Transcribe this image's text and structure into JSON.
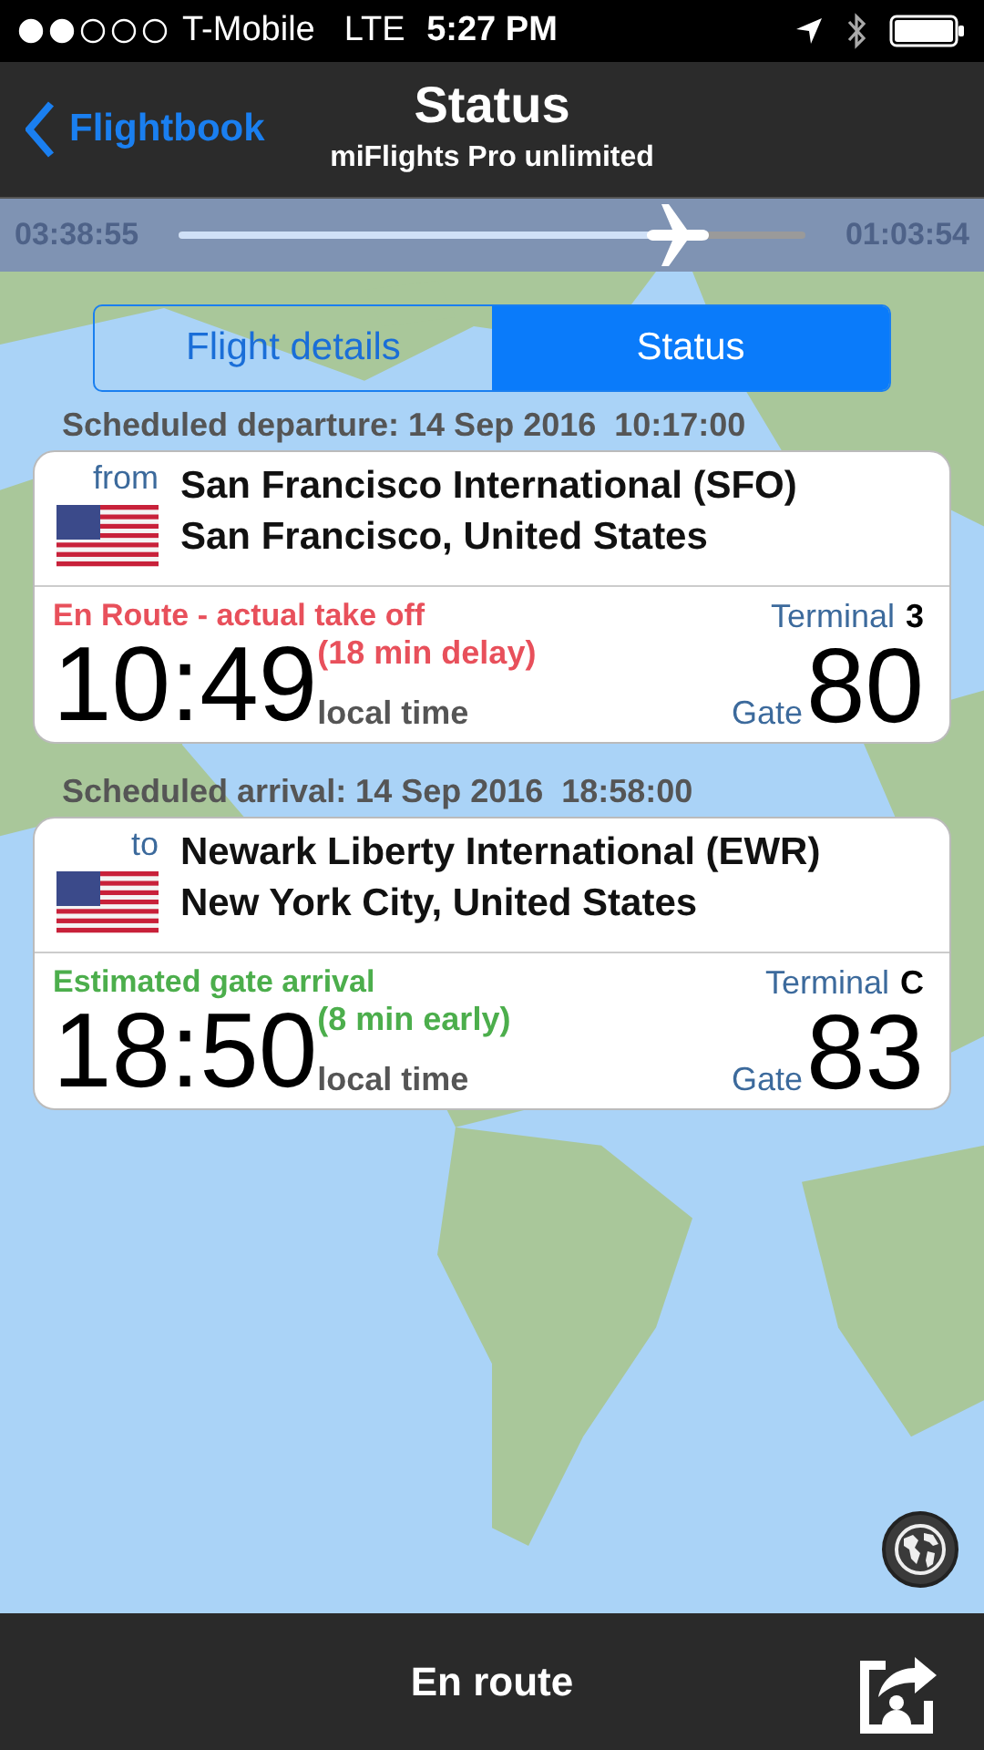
{
  "status_bar": {
    "carrier": "T-Mobile",
    "network": "LTE",
    "time": "5:27 PM"
  },
  "nav": {
    "back": "Flightbook",
    "title": "Status",
    "subtitle": "miFlights Pro unlimited"
  },
  "progress": {
    "elapsed": "03:38:55",
    "remaining": "01:03:54",
    "level": 0.8
  },
  "tabs": [
    {
      "label": "Flight details",
      "selected": false
    },
    {
      "label": "Status",
      "selected": true
    }
  ],
  "legs": [
    {
      "scheduled": "Scheduled departure: 14 Sep 2016  10:17:00",
      "direction": "from",
      "airport": "San Francisco International (SFO)",
      "city": "San Francisco, United States",
      "kind": "delay",
      "status": "En Route - actual take off",
      "time": "10:49",
      "offset": "(18 min delay)",
      "time_note": "local time",
      "terminal_label": "Terminal",
      "terminal": "3",
      "gate_label": "Gate",
      "gate": "80"
    },
    {
      "scheduled": "Scheduled arrival: 14 Sep 2016  18:58:00",
      "direction": "to",
      "airport": "Newark Liberty International (EWR)",
      "city": "New York City, United States",
      "kind": "early",
      "status": "Estimated gate arrival",
      "time": "18:50",
      "offset": "(8 min early)",
      "time_note": "local time",
      "terminal_label": "Terminal",
      "terminal": "C",
      "gate_label": "Gate",
      "gate": "83"
    }
  ],
  "bottom_bar": {
    "label": "En route"
  }
}
